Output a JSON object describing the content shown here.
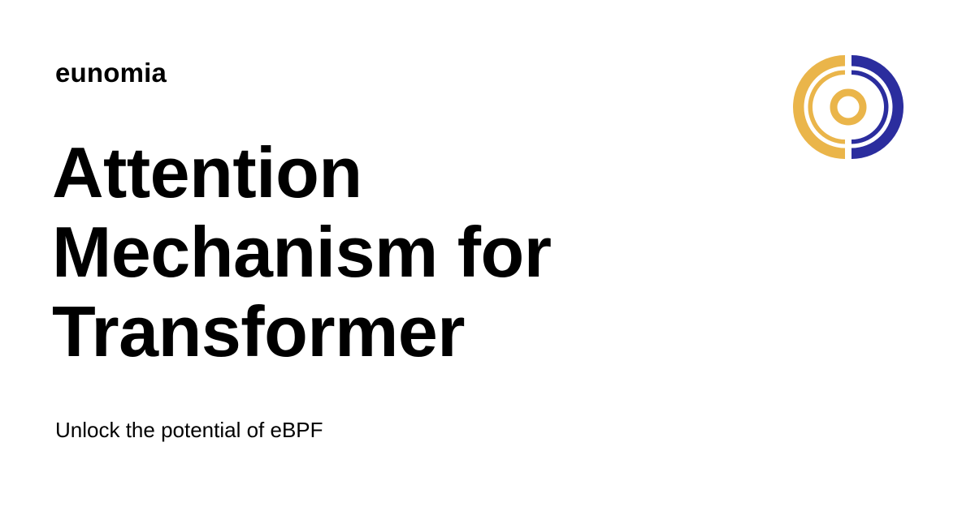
{
  "site": {
    "name": "eunomia",
    "logo_icon": "eunomia-logo-icon",
    "colors": {
      "gold": "#EAB54A",
      "navy": "#2B2D9E",
      "text": "#000000",
      "background": "#FFFFFF"
    }
  },
  "card": {
    "title": "Attention Mechanism for Transformer",
    "subtitle": "Unlock the potential of eBPF"
  }
}
